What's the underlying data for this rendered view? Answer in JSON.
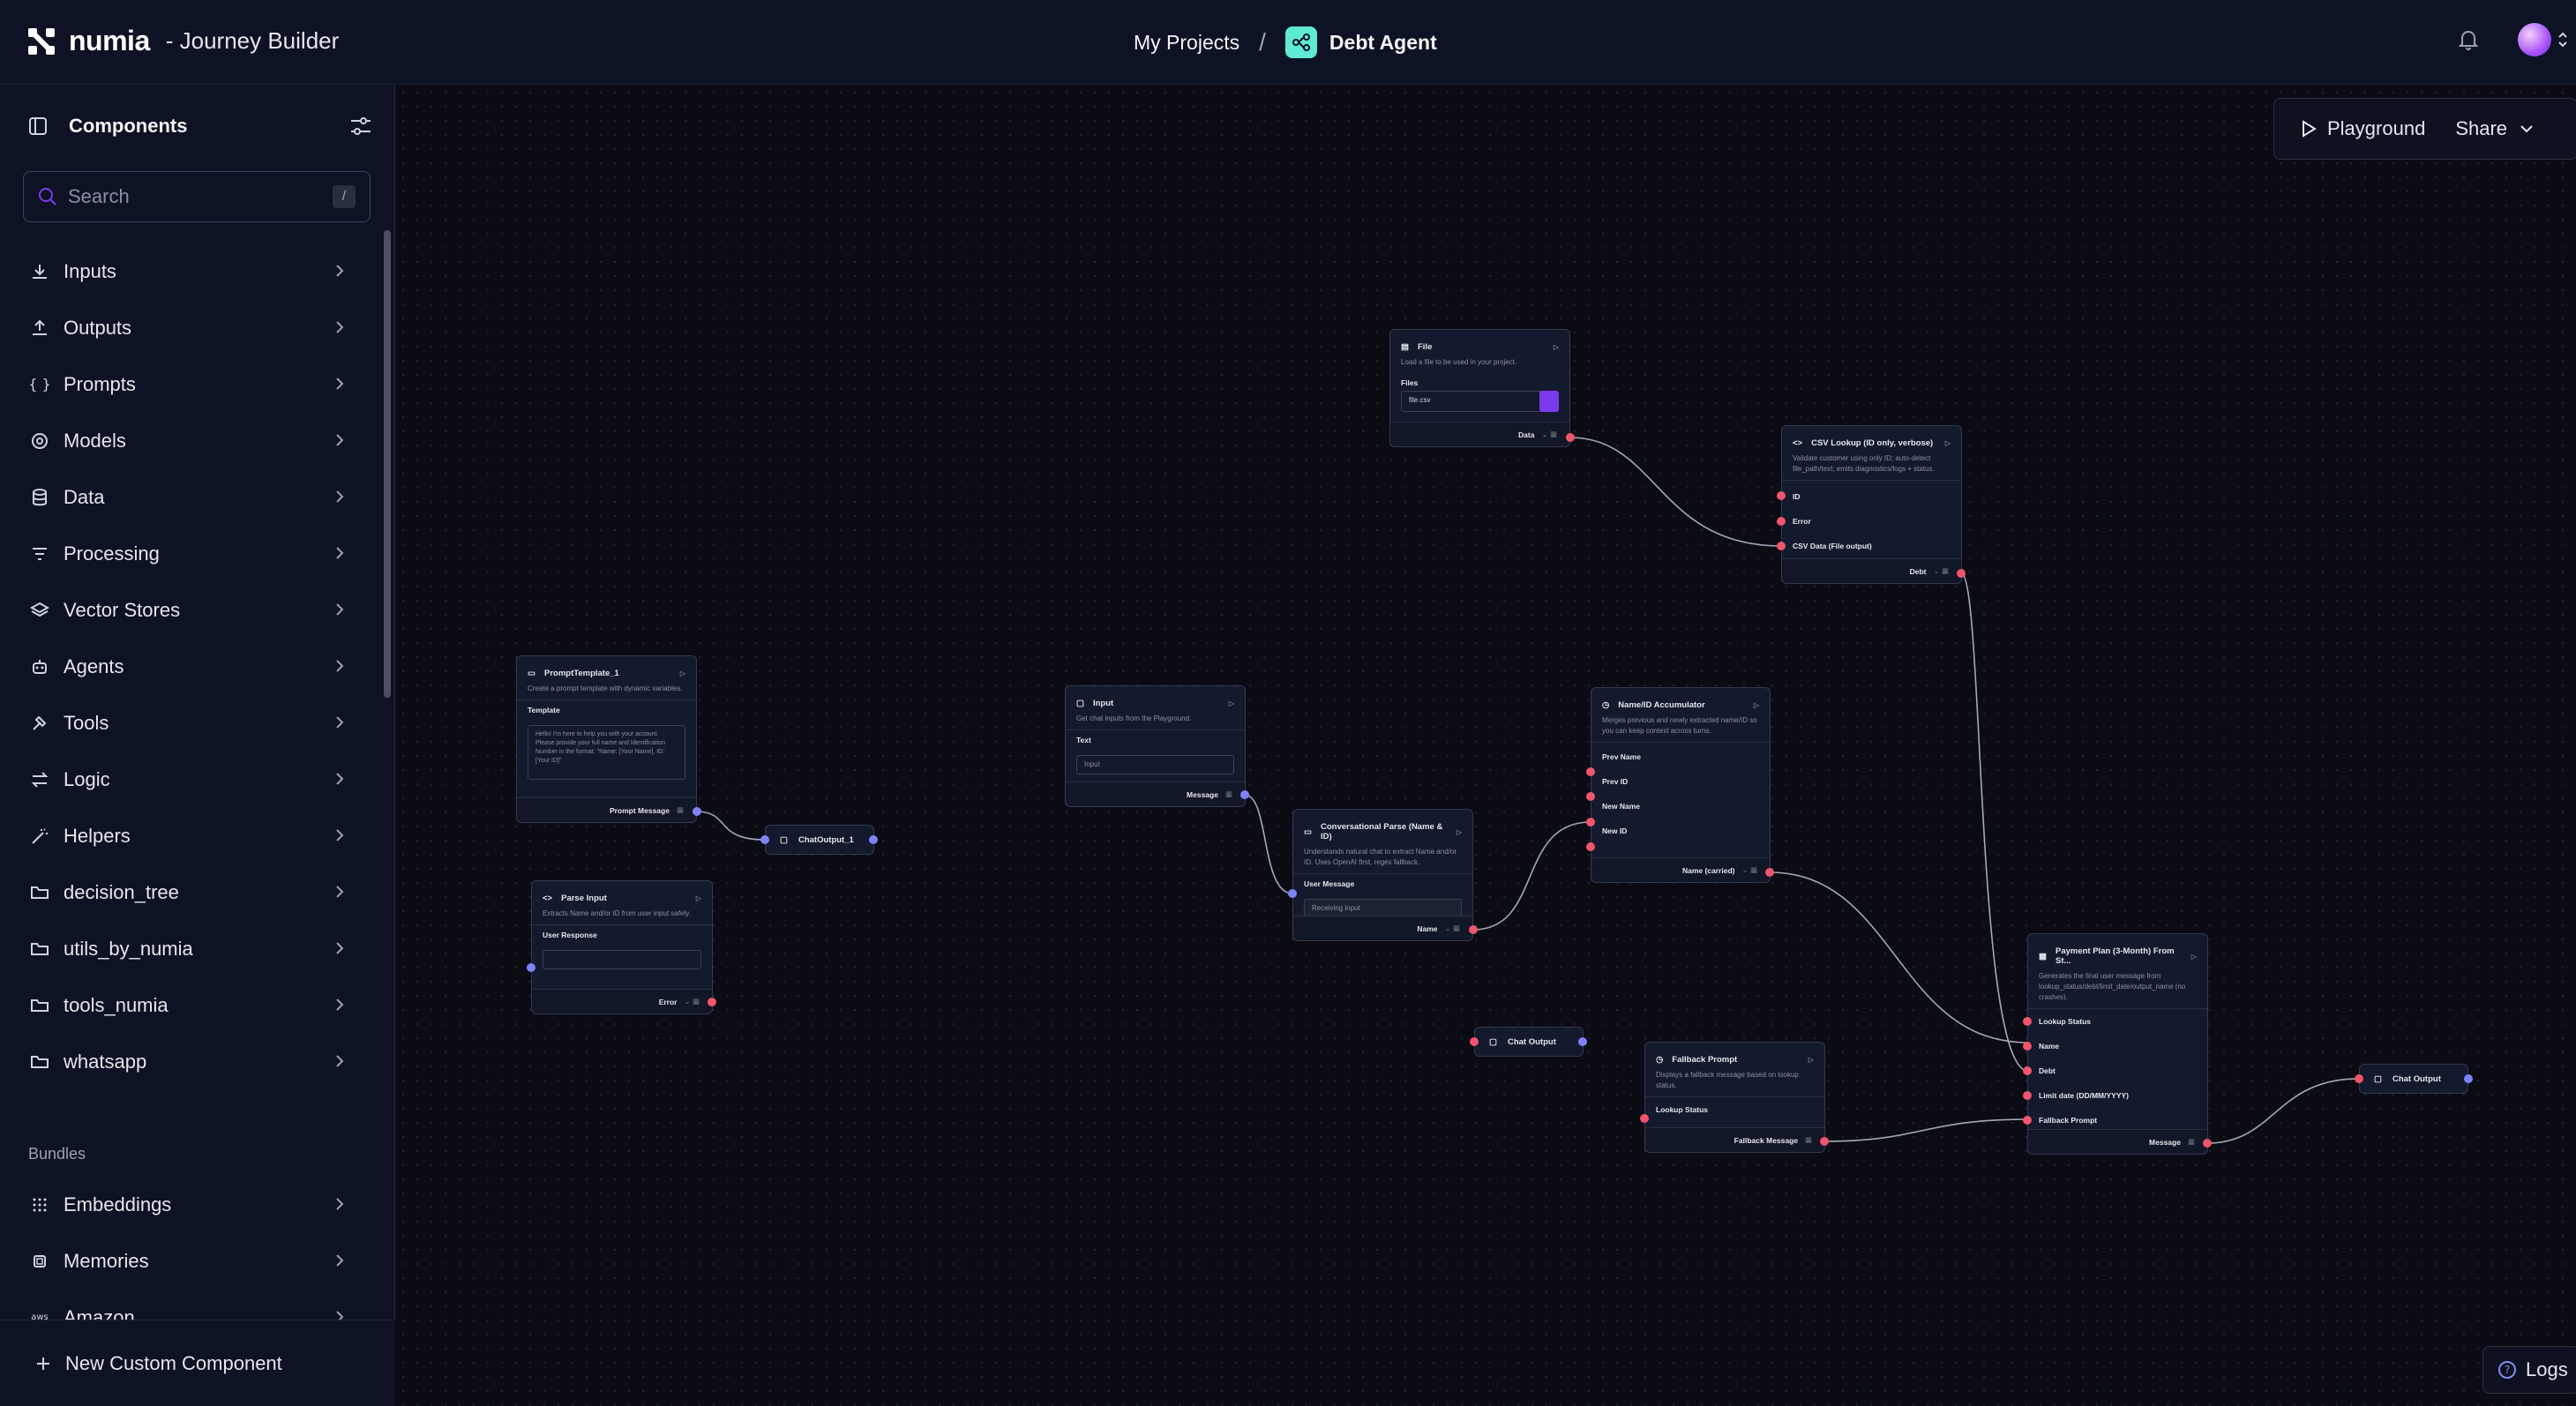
{
  "header": {
    "brand": "numia",
    "app_name": "- Journey Builder",
    "breadcrumb_projects": "My Projects",
    "breadcrumb_sep": "/",
    "project_name": "Debt Agent"
  },
  "sidebar": {
    "title": "Components",
    "search_placeholder": "Search",
    "search_shortcut": "/",
    "categories": [
      {
        "label": "Inputs",
        "icon": "download-icon"
      },
      {
        "label": "Outputs",
        "icon": "upload-icon"
      },
      {
        "label": "Prompts",
        "icon": "braces-icon"
      },
      {
        "label": "Models",
        "icon": "brain-icon"
      },
      {
        "label": "Data",
        "icon": "database-icon"
      },
      {
        "label": "Processing",
        "icon": "filter-icon"
      },
      {
        "label": "Vector Stores",
        "icon": "layers-icon"
      },
      {
        "label": "Agents",
        "icon": "bot-icon"
      },
      {
        "label": "Tools",
        "icon": "hammer-icon"
      },
      {
        "label": "Logic",
        "icon": "arrows-icon"
      },
      {
        "label": "Helpers",
        "icon": "wand-icon"
      },
      {
        "label": "decision_tree",
        "icon": "folder-icon"
      },
      {
        "label": "utils_by_numia",
        "icon": "folder-icon"
      },
      {
        "label": "tools_numia",
        "icon": "folder-icon"
      },
      {
        "label": "whatsapp",
        "icon": "folder-icon"
      }
    ],
    "bundles_title": "Bundles",
    "bundles": [
      {
        "label": "Embeddings",
        "icon": "dots-grid-icon"
      },
      {
        "label": "Memories",
        "icon": "cpu-icon"
      },
      {
        "label": "Amazon",
        "icon": "aws-icon"
      }
    ],
    "new_component": "New Custom Component"
  },
  "toolbar": {
    "playground": "Playground",
    "share": "Share"
  },
  "logs": "Logs",
  "nodes": {
    "file": {
      "title": "File",
      "desc": "Load a file to be used in your project.",
      "field_label": "Files",
      "file_value": "file.csv",
      "output": "Data"
    },
    "csv": {
      "title": "CSV Lookup (ID only, verbose)",
      "desc": "Validate customer using only ID; auto-detect file_path/text; emits diagnostics/logs + status.",
      "inputs": [
        "ID",
        "Error",
        "CSV Data (File output)"
      ],
      "output": "Debt"
    },
    "prompt": {
      "title": "PromptTemplate_1",
      "desc": "Create a prompt template with dynamic variables.",
      "field_label": "Template",
      "template_text": "Hello! I'm here to help you with your account. Please provide your full name and Identification Number in the format: \"Name: [Your Name], ID: [Your ID]\"",
      "output": "Prompt Message"
    },
    "chatout1": {
      "title": "ChatOutput_1"
    },
    "parse_input": {
      "title": "Parse Input",
      "desc": "Extracts Name and/or ID from user input safely.",
      "field_label": "User Response",
      "output": "Error"
    },
    "input": {
      "title": "Input",
      "desc": "Get chat inputs from the Playground.",
      "field_label": "Text",
      "placeholder": "Input",
      "output": "Message"
    },
    "conv": {
      "title": "Conversational Parse (Name & ID)",
      "desc": "Understands natural chat to extract Name and/or ID. Uses OpenAI first, regex fallback.",
      "field_label": "User Message",
      "placeholder": "Receiving input",
      "output": "Name"
    },
    "acc": {
      "title": "Name/ID Accumulator",
      "desc": "Merges previous and newly extracted name/ID so you can keep context across turns.",
      "inputs": [
        "Prev Name",
        "Prev ID",
        "New Name",
        "New ID"
      ],
      "output": "Name (carried)"
    },
    "chatout_mid": {
      "title": "Chat Output"
    },
    "fallback": {
      "title": "Fallback Prompt",
      "desc": "Displays a fallback message based on lookup status.",
      "field_label": "Lookup Status",
      "output": "Fallback Message"
    },
    "payment": {
      "title": "Payment Plan (3-Month) From St...",
      "desc": "Generates the final user message from lookup_status/debt/limit_date/output_name (no crashes).",
      "inputs": [
        "Lookup Status",
        "Name",
        "Debt",
        "Limit date (DD/MM/YYYY)",
        "Fallback Prompt"
      ],
      "output": "Message"
    },
    "chatout_end": {
      "title": "Chat Output"
    }
  },
  "colors": {
    "handle_red": "#f0556b",
    "handle_blue": "#7c83f7",
    "accent_purple": "#7c3aed",
    "edge": "#9ca3af"
  }
}
